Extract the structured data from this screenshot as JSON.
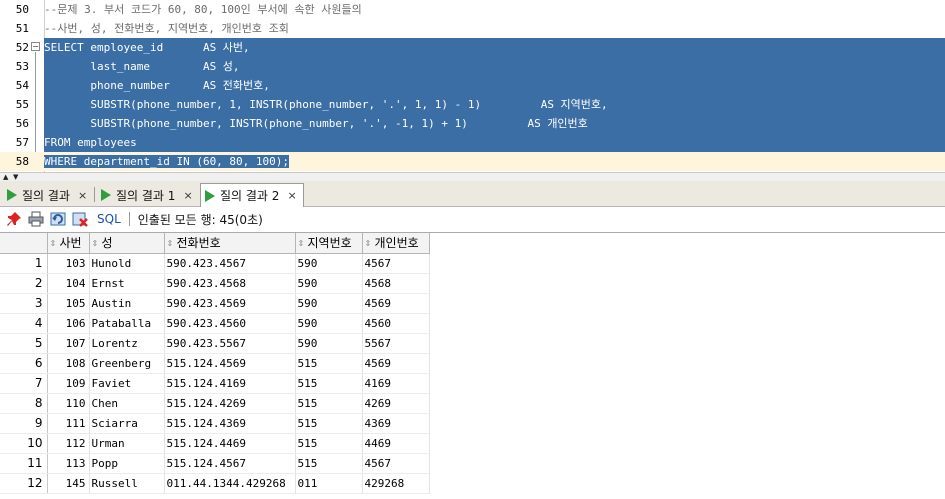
{
  "editor": {
    "lines": [
      {
        "num": "50",
        "text": "--문제 3. 부서 코드가 60, 80, 100인 부서에 속한 사원들의",
        "kind": "comment"
      },
      {
        "num": "51",
        "text": "--사번, 성, 전화번호, 지역번호, 개인번호 조회",
        "kind": "comment"
      },
      {
        "num": "52",
        "text": "SELECT employee_id      AS 사번,",
        "kind": "sel"
      },
      {
        "num": "53",
        "text": "       last_name        AS 성,",
        "kind": "sel"
      },
      {
        "num": "54",
        "text": "       phone_number     AS 전화번호,",
        "kind": "sel"
      },
      {
        "num": "55",
        "text": "       SUBSTR(phone_number, 1, INSTR(phone_number, '.', 1, 1) - 1)         AS 지역번호,",
        "kind": "sel"
      },
      {
        "num": "56",
        "text": "       SUBSTR(phone_number, INSTR(phone_number, '.', -1, 1) + 1)         AS 개인번호",
        "kind": "sel"
      },
      {
        "num": "57",
        "text": "FROM employees",
        "kind": "sel"
      },
      {
        "num": "58",
        "text": "WHERE department_id IN (60, 80, 100);",
        "kind": "sel-last"
      }
    ],
    "fold_symbol": "−"
  },
  "tabs": [
    {
      "label": "질의 결과",
      "close": "×",
      "active": false
    },
    {
      "label": "질의 결과 1",
      "close": "×",
      "active": false
    },
    {
      "label": "질의 결과 2",
      "close": "×",
      "active": true
    }
  ],
  "toolbar": {
    "sql_label": "SQL",
    "status": "인출된 모든 행: 45(0초)",
    "icons": [
      "pin-icon",
      "print-icon",
      "refresh-icon",
      "delete-icon"
    ]
  },
  "grid": {
    "columns": [
      "사번",
      "성",
      "전화번호",
      "지역번호",
      "개인번호"
    ],
    "rows": [
      {
        "n": "1",
        "cells": [
          "103",
          "Hunold",
          "590.423.4567",
          "590",
          "4567"
        ]
      },
      {
        "n": "2",
        "cells": [
          "104",
          "Ernst",
          "590.423.4568",
          "590",
          "4568"
        ]
      },
      {
        "n": "3",
        "cells": [
          "105",
          "Austin",
          "590.423.4569",
          "590",
          "4569"
        ]
      },
      {
        "n": "4",
        "cells": [
          "106",
          "Pataballa",
          "590.423.4560",
          "590",
          "4560"
        ]
      },
      {
        "n": "5",
        "cells": [
          "107",
          "Lorentz",
          "590.423.5567",
          "590",
          "5567"
        ]
      },
      {
        "n": "6",
        "cells": [
          "108",
          "Greenberg",
          "515.124.4569",
          "515",
          "4569"
        ]
      },
      {
        "n": "7",
        "cells": [
          "109",
          "Faviet",
          "515.124.4169",
          "515",
          "4169"
        ]
      },
      {
        "n": "8",
        "cells": [
          "110",
          "Chen",
          "515.124.4269",
          "515",
          "4269"
        ]
      },
      {
        "n": "9",
        "cells": [
          "111",
          "Sciarra",
          "515.124.4369",
          "515",
          "4369"
        ]
      },
      {
        "n": "10",
        "cells": [
          "112",
          "Urman",
          "515.124.4469",
          "515",
          "4469"
        ]
      },
      {
        "n": "11",
        "cells": [
          "113",
          "Popp",
          "515.124.4567",
          "515",
          "4567"
        ]
      },
      {
        "n": "12",
        "cells": [
          "145",
          "Russell",
          "011.44.1344.429268",
          "011",
          "429268"
        ]
      }
    ]
  },
  "colors": {
    "selection": "#3a6ea5",
    "current_line": "#fdf6dc",
    "run_icon": "#2e9e3e",
    "sql_link": "#1f4fa3"
  }
}
